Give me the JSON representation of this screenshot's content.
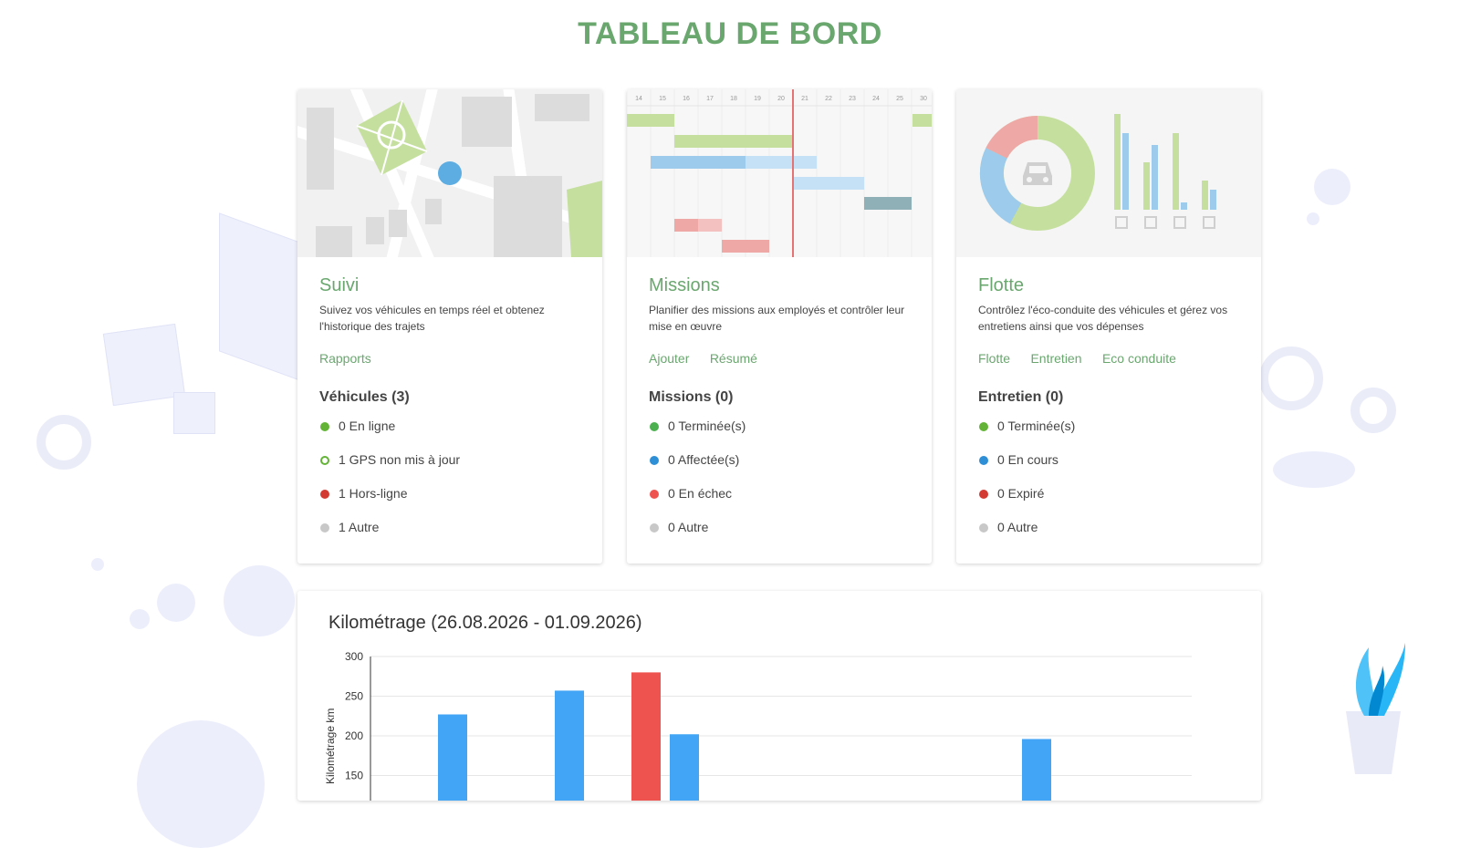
{
  "page": {
    "title": "TABLEAU DE BORD"
  },
  "colors": {
    "accent_green": "#6aa76f",
    "status_green": "#62b336",
    "status_blue": "#2f8fd6",
    "status_red": "#d33a32",
    "status_grey": "#c8c8c8",
    "bar_blue": "#42a5f5",
    "bar_red": "#ef5350"
  },
  "cards": [
    {
      "id": "suivi",
      "title": "Suivi",
      "description": "Suivez vos véhicules en temps réel et obtenez l'historique des trajets",
      "links": [
        "Rapports"
      ],
      "stats_title": "Véhicules (3)",
      "stats": [
        {
          "label": "0 En ligne",
          "status": "green"
        },
        {
          "label": "1 GPS non mis à jour",
          "status": "green-outline"
        },
        {
          "label": "1 Hors-ligne",
          "status": "red"
        },
        {
          "label": "1 Autre",
          "status": "grey"
        }
      ]
    },
    {
      "id": "missions",
      "title": "Missions",
      "description": "Planifier des missions aux employés et contrôler leur mise en œuvre",
      "links": [
        "Ajouter",
        "Résumé"
      ],
      "stats_title": "Missions (0)",
      "stats": [
        {
          "label": "0 Terminée(s)",
          "status": "green"
        },
        {
          "label": "0 Affectée(s)",
          "status": "blue"
        },
        {
          "label": "0 En échec",
          "status": "red"
        },
        {
          "label": "0 Autre",
          "status": "grey"
        }
      ]
    },
    {
      "id": "flotte",
      "title": "Flotte",
      "description": "Contrôlez l'éco-conduite des véhicules et gérez vos entretiens ainsi que vos dépenses",
      "links": [
        "Flotte",
        "Entretien",
        "Eco conduite"
      ],
      "stats_title": "Entretien (0)",
      "stats": [
        {
          "label": "0 Terminée(s)",
          "status": "green"
        },
        {
          "label": "0 En cours",
          "status": "blue"
        },
        {
          "label": "0 Expiré",
          "status": "red"
        },
        {
          "label": "0 Autre",
          "status": "grey"
        }
      ]
    }
  ],
  "gantt_days": [
    "14",
    "15",
    "16",
    "17",
    "18",
    "19",
    "20",
    "21",
    "22",
    "23",
    "24",
    "25",
    "30"
  ],
  "chart_data": {
    "type": "bar",
    "title": "Kilométrage (26.08.2026 - 01.09.2026)",
    "ylabel": "Kilométrage km",
    "ylim": [
      0,
      300
    ],
    "yticks": [
      150,
      200,
      250,
      300
    ],
    "grid": true,
    "bars": [
      {
        "index": 0,
        "value": 227,
        "color": "blue"
      },
      {
        "index": 1,
        "value": 257,
        "color": "blue"
      },
      {
        "index": 2,
        "value": 280,
        "color": "red"
      },
      {
        "index": 3,
        "value": 202,
        "color": "blue"
      },
      {
        "index": 4,
        "value": 196,
        "color": "blue"
      }
    ]
  }
}
